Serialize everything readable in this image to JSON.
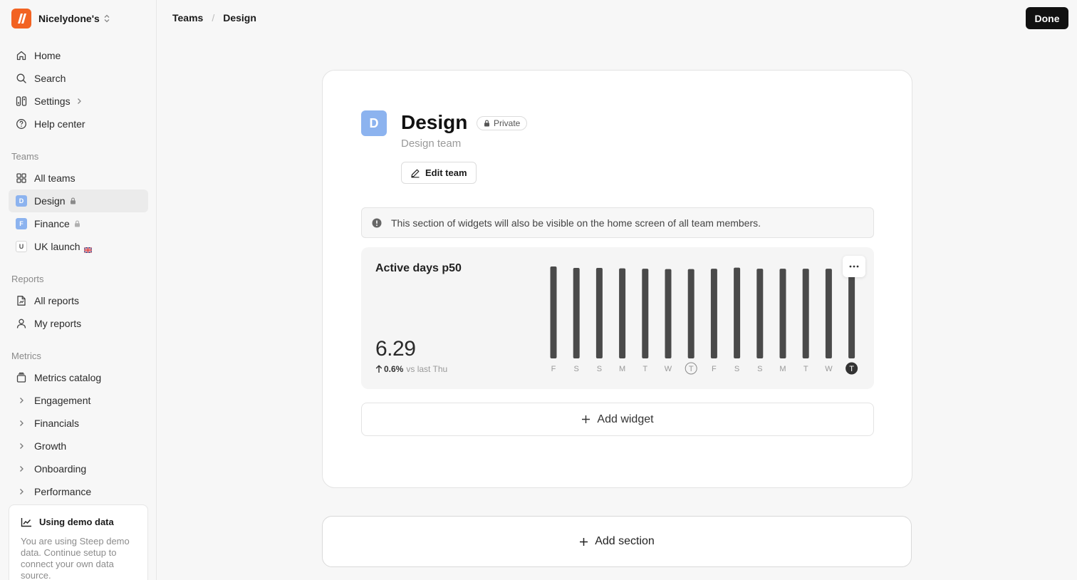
{
  "workspace": {
    "name": "Nicelydone's"
  },
  "nav": [
    {
      "label": "Home",
      "icon": "home-icon"
    },
    {
      "label": "Search",
      "icon": "search-icon"
    },
    {
      "label": "Settings",
      "icon": "settings-icon"
    },
    {
      "label": "Help center",
      "icon": "help-icon"
    }
  ],
  "teams_section": {
    "label": "Teams",
    "all_teams": "All teams",
    "items": [
      {
        "badge": "D",
        "label": "Design"
      },
      {
        "badge": "F",
        "label": "Finance"
      },
      {
        "badge": "U",
        "label": "UK launch"
      }
    ]
  },
  "reports_section": {
    "label": "Reports",
    "items": [
      "All reports",
      "My reports"
    ]
  },
  "metrics_section": {
    "label": "Metrics",
    "catalog": "Metrics catalog",
    "groups": [
      "Engagement",
      "Financials",
      "Growth",
      "Onboarding",
      "Performance"
    ]
  },
  "demo": {
    "title": "Using demo data",
    "text": "You are using Steep demo data. Continue setup to connect your own data source."
  },
  "breadcrumb": {
    "parent": "Teams",
    "sep": "/",
    "current": "Design"
  },
  "done_label": "Done",
  "team": {
    "avatar": "D",
    "name": "Design",
    "visibility": "Private",
    "description": "Design team",
    "edit_label": "Edit team"
  },
  "notice": "This section of widgets will also be visible on the home screen of all team members.",
  "widget": {
    "title": "Active days p50",
    "value": "6.29",
    "delta_pct": "0.6%",
    "delta_text": "vs last Thu",
    "bar_color": "#4a4a4a"
  },
  "chart_data": {
    "type": "bar",
    "categories": [
      "F",
      "S",
      "S",
      "M",
      "T",
      "W",
      "T",
      "F",
      "S",
      "S",
      "M",
      "T",
      "W",
      "T"
    ],
    "values": [
      6.35,
      6.25,
      6.25,
      6.22,
      6.2,
      6.17,
      6.17,
      6.2,
      6.27,
      6.2,
      6.2,
      6.2,
      6.2,
      6.29
    ],
    "ylim": [
      0,
      6.4
    ],
    "highlighted_categories": [
      6,
      13
    ],
    "grid": false
  },
  "add_widget_label": "Add widget",
  "add_section_label": "Add section"
}
